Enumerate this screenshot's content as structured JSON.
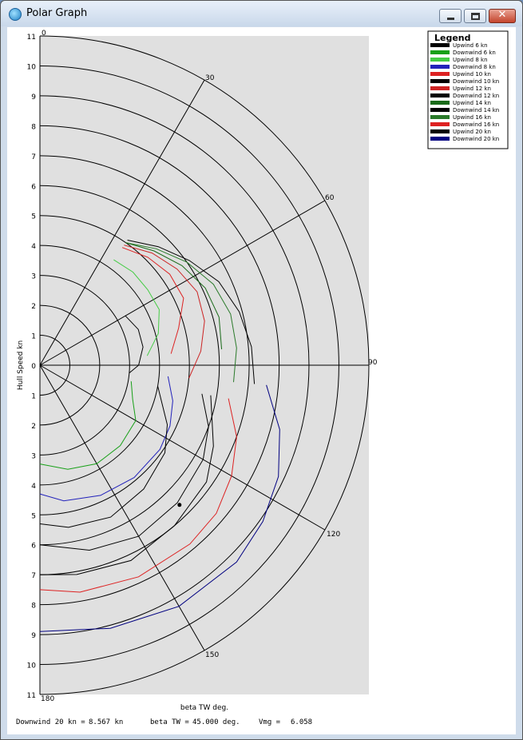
{
  "window": {
    "title": "Polar Graph",
    "close_glyph": "✕"
  },
  "chart_data": {
    "type": "polar-line",
    "xlabel": "beta TW  deg.",
    "ylabel": "Hull Speed  kn",
    "rmax": 11,
    "radius_ticks_upper": [
      "11",
      "10",
      "9",
      "8",
      "7",
      "6",
      "5",
      "4",
      "3",
      "2",
      "1",
      "0"
    ],
    "radius_ticks_lower": [
      "1",
      "2",
      "3",
      "4",
      "5",
      "6",
      "7",
      "8",
      "9",
      "10",
      "11"
    ],
    "angle_labels": [
      "0",
      "30",
      "60",
      "90",
      "120",
      "150",
      "180"
    ],
    "legend_title": "Legend",
    "series": [
      {
        "name": "Upwind 6 kn",
        "color": "#000000",
        "points": [
          [
            60,
            3.3
          ],
          [
            70,
            3.5
          ],
          [
            80,
            3.5
          ],
          [
            90,
            3.3
          ],
          [
            95,
            3.0
          ]
        ]
      },
      {
        "name": "Downwind 6 kn",
        "color": "#18a018",
        "points": [
          [
            100,
            3.1
          ],
          [
            110,
            3.3
          ],
          [
            120,
            3.7
          ],
          [
            135,
            3.8
          ],
          [
            150,
            3.8
          ],
          [
            165,
            3.6
          ],
          [
            180,
            3.3
          ]
        ]
      },
      {
        "name": "Upwind 8 kn",
        "color": "#44cc44",
        "points": [
          [
            35,
            4.3
          ],
          [
            45,
            4.4
          ],
          [
            55,
            4.4
          ],
          [
            65,
            4.4
          ],
          [
            75,
            4.1
          ],
          [
            85,
            3.6
          ]
        ]
      },
      {
        "name": "Downwind 8 kn",
        "color": "#2222bb",
        "points": [
          [
            95,
            4.3
          ],
          [
            105,
            4.6
          ],
          [
            115,
            4.8
          ],
          [
            125,
            4.9
          ],
          [
            140,
            4.9
          ],
          [
            155,
            4.8
          ],
          [
            170,
            4.6
          ],
          [
            180,
            4.3
          ]
        ]
      },
      {
        "name": "Upwind 10 kn",
        "color": "#dd2222",
        "points": [
          [
            35,
            4.8
          ],
          [
            45,
            5.1
          ],
          [
            55,
            5.3
          ],
          [
            65,
            5.3
          ],
          [
            75,
            4.8
          ],
          [
            85,
            4.4
          ]
        ]
      },
      {
        "name": "Downwind 10 kn",
        "color": "#000000",
        "points": [
          [
            100,
            4.0
          ],
          [
            115,
            4.7
          ],
          [
            125,
            5.1
          ],
          [
            140,
            5.4
          ],
          [
            155,
            5.6
          ],
          [
            170,
            5.5
          ],
          [
            180,
            5.3
          ]
        ]
      },
      {
        "name": "Upwind 12 kn",
        "color": "#cc2222",
        "points": [
          [
            35,
            4.9
          ],
          [
            45,
            5.3
          ],
          [
            55,
            5.6
          ],
          [
            65,
            5.8
          ],
          [
            75,
            5.7
          ],
          [
            85,
            5.4
          ],
          [
            95,
            5.0
          ]
        ]
      },
      {
        "name": "Downwind 12 kn",
        "color": "#000000",
        "points": [
          [
            100,
            5.5
          ],
          [
            110,
            6.0
          ],
          [
            120,
            6.3
          ],
          [
            135,
            6.5
          ],
          [
            150,
            6.6
          ],
          [
            165,
            6.4
          ],
          [
            180,
            6.0
          ]
        ]
      },
      {
        "name": "Upwind 14 kn",
        "color": "#1a6b1a",
        "points": [
          [
            35,
            5.0
          ],
          [
            45,
            5.4
          ],
          [
            55,
            5.8
          ],
          [
            65,
            6.1
          ],
          [
            75,
            6.2
          ],
          [
            85,
            6.1
          ]
        ]
      },
      {
        "name": "Downwind 14 kn",
        "color": "#000000",
        "points": [
          [
            100,
            5.8
          ],
          [
            115,
            6.4
          ],
          [
            125,
            6.8
          ],
          [
            140,
            7.0
          ],
          [
            155,
            7.2
          ],
          [
            170,
            7.1
          ],
          [
            180,
            7.0
          ]
        ]
      },
      {
        "name": "Upwind 16 kn",
        "color": "#2a7a2a",
        "points": [
          [
            35,
            5.0
          ],
          [
            45,
            5.5
          ],
          [
            55,
            6.0
          ],
          [
            65,
            6.4
          ],
          [
            75,
            6.6
          ],
          [
            85,
            6.6
          ],
          [
            95,
            6.5
          ]
        ]
      },
      {
        "name": "Downwind 16 kn",
        "color": "#dd2222",
        "points": [
          [
            100,
            6.4
          ],
          [
            110,
            7.0
          ],
          [
            120,
            7.4
          ],
          [
            130,
            7.7
          ],
          [
            140,
            7.8
          ],
          [
            155,
            7.8
          ],
          [
            170,
            7.7
          ],
          [
            180,
            7.5
          ]
        ]
      },
      {
        "name": "Upwind 20 kn",
        "color": "#000000",
        "points": [
          [
            35,
            5.1
          ],
          [
            45,
            5.6
          ],
          [
            55,
            6.1
          ],
          [
            65,
            6.6
          ],
          [
            75,
            6.9
          ],
          [
            85,
            7.1
          ],
          [
            95,
            7.2
          ]
        ]
      },
      {
        "name": "Downwind 20 kn",
        "color": "#000080",
        "points": [
          [
            95,
            7.6
          ],
          [
            105,
            8.3
          ],
          [
            115,
            8.8
          ],
          [
            125,
            9.1
          ],
          [
            135,
            9.3
          ],
          [
            150,
            9.3
          ],
          [
            165,
            9.1
          ],
          [
            180,
            8.9
          ]
        ]
      }
    ],
    "marker": {
      "beta_deg": 135,
      "speed": 6.6
    }
  },
  "status": {
    "downwind_label": "Downwind 20 kn =",
    "downwind_value": "8.567 kn",
    "beta_label": "beta TW =",
    "beta_value": "45.000 deg.",
    "vmg_label": "Vmg =",
    "vmg_value": "6.058"
  }
}
